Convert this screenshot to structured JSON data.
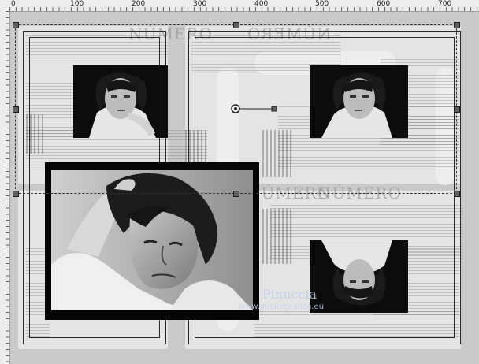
{
  "ruler": {
    "top_numbers": [
      "0",
      "100",
      "200",
      "300",
      "400",
      "500",
      "600",
      "700"
    ]
  },
  "canvas": {
    "header_words": [
      "NÚMERO",
      "NÚMERO",
      "NÚMERO",
      "NÚMERO"
    ],
    "watermark_name": "Pinuccia",
    "watermark_site": "www.inidiregrafica.eu"
  },
  "colors": {
    "background": "#c9c9c9",
    "panel": "#e4e4e4",
    "ruler": "#ececec"
  },
  "icons": {
    "selection_handle": "square-handle",
    "rotation_pivot": "circle-pivot"
  }
}
